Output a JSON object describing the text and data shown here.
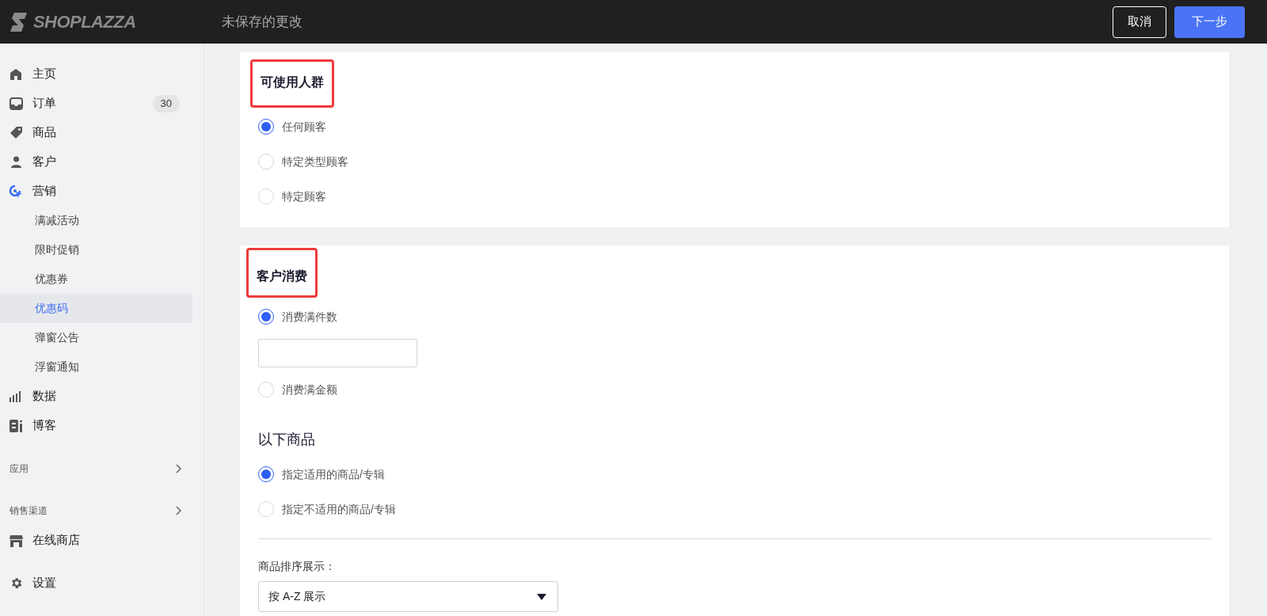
{
  "header": {
    "logo": "SHOPLAZZA",
    "title": "未保存的更改",
    "buttons": [
      {
        "label": "取消",
        "kind": "secondary"
      },
      {
        "label": "下一步",
        "kind": "primary"
      }
    ]
  },
  "sidebar": {
    "items": [
      {
        "kind": "nav",
        "label": "主页",
        "selected": false
      },
      {
        "kind": "nav",
        "label": "订单",
        "badge": "30",
        "selected": false
      },
      {
        "kind": "nav",
        "label": "商品",
        "selected": false
      },
      {
        "kind": "nav",
        "label": "客户",
        "selected": false
      },
      {
        "kind": "nav",
        "label": "营销",
        "selected": false,
        "children": [
          {
            "label": "满减活动",
            "selected": false
          },
          {
            "label": "限时促销",
            "selected": false
          },
          {
            "label": "优惠券",
            "selected": false
          },
          {
            "label": "优惠码",
            "selected": true
          },
          {
            "label": "弹窗公告",
            "selected": false
          },
          {
            "label": "浮窗通知",
            "selected": false
          }
        ]
      },
      {
        "kind": "nav",
        "label": "数据",
        "selected": false
      },
      {
        "kind": "nav",
        "label": "博客",
        "selected": false
      },
      {
        "kind": "section",
        "label": "应用"
      },
      {
        "kind": "section",
        "label": "销售渠道"
      },
      {
        "kind": "nav",
        "label": "在线商店",
        "selected": false
      },
      {
        "kind": "nav",
        "label": "设置",
        "selected": false
      }
    ]
  },
  "cards": [
    {
      "title": "可使用人群",
      "highlighted": true,
      "items": [
        {
          "kind": "radio",
          "label": "任何顾客",
          "selected": true
        },
        {
          "kind": "radio",
          "label": "特定类型顾客",
          "selected": false
        },
        {
          "kind": "radio",
          "label": "特定顾客",
          "selected": false
        }
      ]
    },
    {
      "title": "客户消费",
      "highlighted": true,
      "items": [
        {
          "kind": "radio",
          "label": "消费满件数",
          "selected": true
        },
        {
          "kind": "input"
        },
        {
          "kind": "radio",
          "label": "消费满金额",
          "selected": false
        },
        {
          "kind": "heading",
          "label": "以下商品"
        },
        {
          "kind": "radio",
          "label": "指定适用的商品/专辑",
          "selected": true
        },
        {
          "kind": "radio",
          "label": "指定不适用的商品/专辑",
          "selected": false
        },
        {
          "kind": "divider"
        },
        {
          "kind": "select",
          "label": "商品排序展示：",
          "value": "按 A-Z 展示"
        }
      ]
    }
  ]
}
